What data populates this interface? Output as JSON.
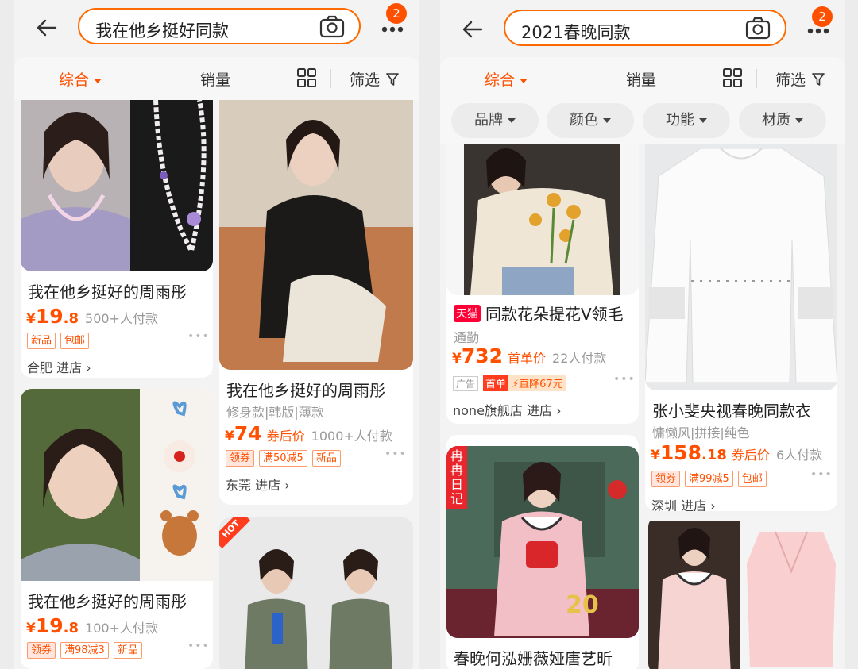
{
  "badge_count": "2",
  "left": {
    "search_query": "我在他乡挺好同款",
    "sort": {
      "comprehensive": "综合",
      "sales": "销量",
      "filter": "筛选"
    },
    "products": [
      {
        "title": "我在他乡挺好的周雨彤",
        "currency": "¥",
        "price_int": "19",
        "price_dec": ".8",
        "sold": "500+人付款",
        "tags": [
          "新品",
          "包邮"
        ],
        "shop": "合肥",
        "enter": "进店 ›"
      },
      {
        "title": "我在他乡挺好的周雨彤",
        "attrs": "修身款|韩版|薄款",
        "currency": "¥",
        "price_int": "74",
        "price_label": "券后价",
        "sold": "1000+人付款",
        "tags": [
          "领券",
          "满50减5",
          "新品"
        ],
        "shop": "东莞",
        "enter": "进店 ›"
      },
      {
        "title": "我在他乡挺好的周雨彤",
        "currency": "¥",
        "price_int": "19",
        "price_dec": ".8",
        "sold": "100+人付款",
        "tags": [
          "领券",
          "满98减3",
          "新品"
        ]
      },
      {
        "hot_label": "HOT"
      }
    ]
  },
  "right": {
    "search_query": "2021春晚同款",
    "sort": {
      "comprehensive": "综合",
      "sales": "销量",
      "filter": "筛选"
    },
    "filter_chips": [
      "品牌",
      "颜色",
      "功能",
      "材质"
    ],
    "products": [
      {
        "tmall_label": "天猫",
        "title": "同款花朵提花V领毛",
        "subtitle": "通勤",
        "currency": "¥",
        "price_int": "732",
        "price_label": "首单价",
        "sold": "22人付款",
        "ad_label": "广告",
        "promo_first": "首单",
        "promo_drop": "直降67元",
        "shop": "none旗舰店",
        "enter": "进店 ›"
      },
      {
        "title": "张小斐央视春晚同款衣",
        "attrs": "慵懒风|拼接|纯色",
        "currency": "¥",
        "price_int": "158",
        "price_dec": ".18",
        "price_label": "券后价",
        "sold": "6人付款",
        "tags": [
          "领券",
          "满99减5",
          "包邮"
        ],
        "shop": "深圳",
        "enter": "进店 ›"
      },
      {
        "ribbon": "冉冉日记",
        "title": "春晚何泓姗薇娅唐艺昕"
      },
      {}
    ]
  }
}
